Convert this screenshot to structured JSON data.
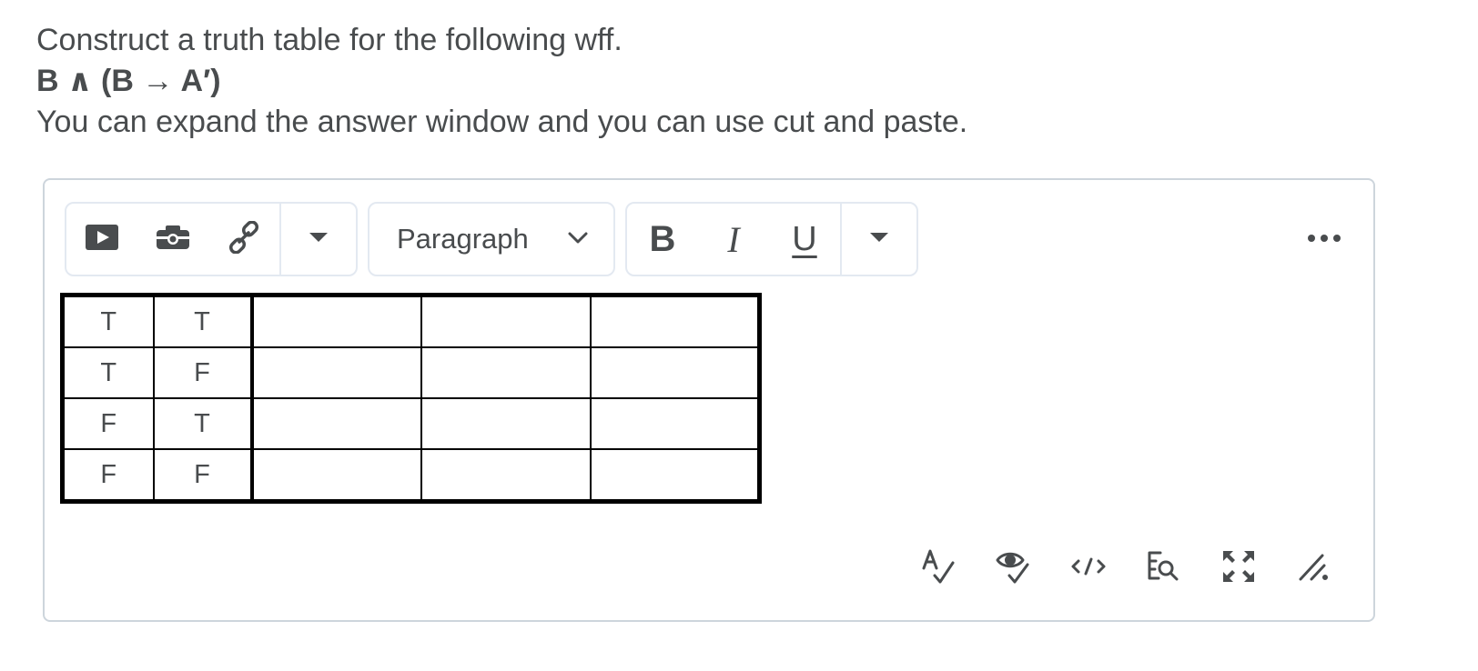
{
  "question": {
    "prompt": "Construct a truth table for the following wff.",
    "formula": "B ∧ (B → A′)",
    "instructions": "You can expand the answer window and you can use cut and paste."
  },
  "toolbar": {
    "insert_group": {
      "icons": [
        "video-icon",
        "camera-icon",
        "link-icon"
      ],
      "more": "chevron-down-icon"
    },
    "format_select": {
      "value": "Paragraph"
    },
    "style_group": {
      "bold": "B",
      "italic": "I",
      "underline": "U"
    },
    "overflow": "more-options-icon"
  },
  "truth_table": {
    "rows": [
      [
        "T",
        "T",
        "",
        "",
        ""
      ],
      [
        "T",
        "F",
        "",
        "",
        ""
      ],
      [
        "F",
        "T",
        "",
        "",
        ""
      ],
      [
        "F",
        "F",
        "",
        "",
        ""
      ]
    ]
  },
  "status_bar": {
    "icons": [
      "spellcheck-icon",
      "accessibility-check-icon",
      "source-code-icon",
      "find-replace-icon",
      "fullscreen-icon",
      "resize-handle-icon"
    ]
  },
  "colors": {
    "text": "#494c4e",
    "border": "#cdd5dc",
    "group_border": "#e3e9f1"
  }
}
